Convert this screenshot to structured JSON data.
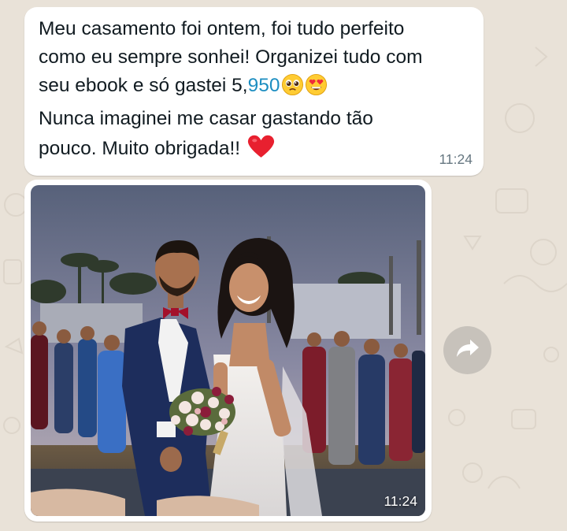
{
  "chat": {
    "messages": [
      {
        "type": "text",
        "lines": [
          "Meu casamento foi ontem, foi tudo perfeito",
          "como eu sempre sonhei! Organizei tudo com",
          "seu ebook e só gastei 5,",
          "Nunca imaginei me casar gastando tão",
          "pouco. Muito obrigada!! "
        ],
        "link_text": "950",
        "emojis": [
          "pleading-face-emoji",
          "heart-eyes-emoji",
          "red-heart-emoji"
        ],
        "time": "11:24"
      },
      {
        "type": "image",
        "image_description_icon": "wedding-couple-photo",
        "time": "11:24"
      }
    ],
    "forward_icon": "forward-arrow-icon",
    "colors": {
      "wallpaper": "#e9e2d8",
      "bubble": "#ffffff",
      "text": "#111b21",
      "timestamp": "#667781",
      "link": "#1d8ec1",
      "forward_button": "#c7c2bb"
    }
  }
}
